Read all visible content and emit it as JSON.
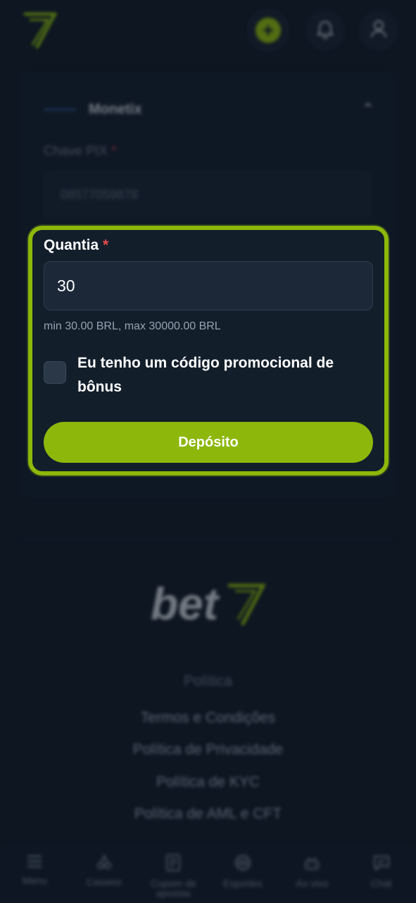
{
  "header": {
    "logo_icon": "bet7-mark-icon",
    "add_funds_icon": "plus-icon",
    "notifications_icon": "bell-icon",
    "profile_icon": "user-icon"
  },
  "payment": {
    "provider": "Monetix",
    "pix_label": "Chave PIX",
    "pix_required": "*",
    "pix_value": "08577059878"
  },
  "form": {
    "amount_label": "Quantia",
    "amount_required": "*",
    "amount_value": "30",
    "limits": "min 30.00 BRL, max 30000.00 BRL",
    "promo_label": "Eu tenho um código promocional de bônus",
    "promo_checked": false,
    "deposit_button": "Depósito"
  },
  "footer": {
    "brand": "bet7",
    "section_title": "Política",
    "links": [
      "Termos e Condições",
      "Política de Privacidade",
      "Política de KYC",
      "Política de AML e CFT"
    ]
  },
  "tabbar": [
    {
      "label": "Menu",
      "icon": "menu-icon"
    },
    {
      "label": "Cassino",
      "icon": "cherries-icon"
    },
    {
      "label": "Cupom de apostas",
      "icon": "ticket-icon"
    },
    {
      "label": "Esportes",
      "icon": "basketball-icon"
    },
    {
      "label": "Ao vivo",
      "icon": "live-icon"
    },
    {
      "label": "Chat",
      "icon": "chat-icon"
    }
  ],
  "colors": {
    "accent": "#8db80b",
    "background": "#0f1a26",
    "required": "#e84b4b"
  }
}
